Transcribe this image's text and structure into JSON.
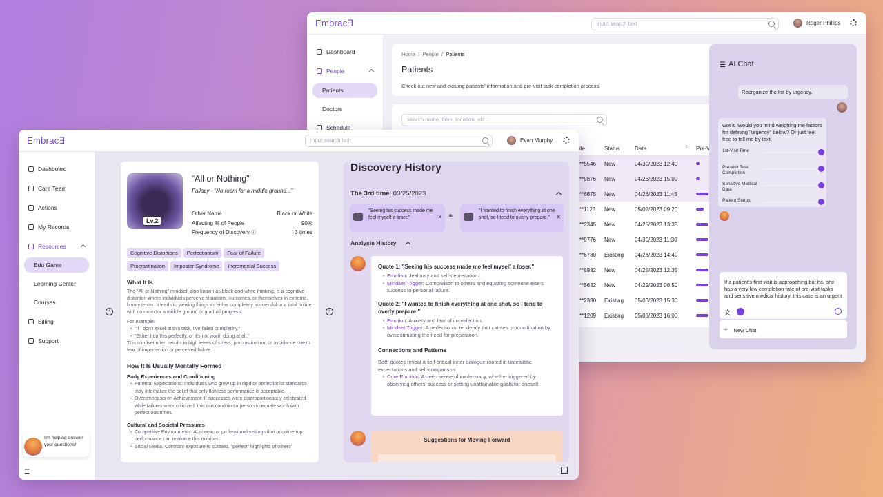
{
  "back_window": {
    "logo": "Embrac∃",
    "search_placeholder": "input search text",
    "user_name": "Roger Phillips",
    "nav": [
      {
        "label": "Dashboard"
      },
      {
        "label": "People"
      },
      {
        "label": "Patients"
      },
      {
        "label": "Doctors"
      },
      {
        "label": "Schedule"
      }
    ],
    "breadcrumb": {
      "home": "Home",
      "sep1": "/",
      "people": "People",
      "sep2": "/",
      "current": "Patients"
    },
    "page_title": "Patients",
    "page_subtitle": "Check out new and existing patients' information and pre-visit task completion process.",
    "filter_placeholder": "search name, time, location, etc...",
    "table": {
      "headers": [
        "ile",
        "Status",
        "Date",
        "Pre-V"
      ],
      "rows": [
        {
          "id": "**5546",
          "status": "New",
          "date": "04/30/2023 12:40",
          "progress": 0.05
        },
        {
          "id": "**9876",
          "status": "New",
          "date": "04/26/2023 15:00",
          "progress": 0.05
        },
        {
          "id": "**6675",
          "status": "New",
          "date": "04/26/2023 11:45",
          "progress": 0.6
        },
        {
          "id": "**1123",
          "status": "New",
          "date": "05/02/2023 09:20",
          "progress": 0.35
        },
        {
          "id": "**2345",
          "status": "New",
          "date": "04/25/2023 13:35",
          "progress": 0.6
        },
        {
          "id": "**9776",
          "status": "New",
          "date": "04/30/2023 11:30",
          "progress": 0.6
        },
        {
          "id": "**6780",
          "status": "Existing",
          "date": "04/28/2023 14:40",
          "progress": 0.6
        },
        {
          "id": "**8932",
          "status": "New",
          "date": "04/25/2023 12:35",
          "progress": 0.6
        },
        {
          "id": "**5632",
          "status": "New",
          "date": "04/29/2023 08:50",
          "progress": 0.6
        },
        {
          "id": "**2330",
          "status": "Existing",
          "date": "05/03/2023 15:30",
          "progress": 0.6
        },
        {
          "id": "**1209",
          "status": "Existing",
          "date": "05/03/2023 16:00",
          "progress": 0.6
        }
      ]
    },
    "ai_chat": {
      "title": "AI Chat",
      "user_msg": "Reorganize the list by urgency.",
      "bot_msg": "Got it. Would you mind weighing the factors for defining \"urgency\" below? Or just feel free to tell me by text.",
      "factors": [
        {
          "label": "1st-Visit Time",
          "value": 1.0
        },
        {
          "label": "Pre-visit Task Completion",
          "value": 1.0
        },
        {
          "label": "Sensitive Medical Data",
          "value": 1.0
        },
        {
          "label": "Patient Status",
          "value": 1.0
        }
      ],
      "input_text": "If a patient's first visit is approaching but he/ she has a very low completion rate of pre-visit tasks and sensitive medical history, this case is an urgent one for me.",
      "new_chat": "New Chat"
    }
  },
  "front_window": {
    "logo": "Embrac∃",
    "search_placeholder": "input search text",
    "user_name": "Evan Murphy",
    "nav": [
      {
        "label": "Dashboard"
      },
      {
        "label": "Care Team"
      },
      {
        "label": "Actions"
      },
      {
        "label": "My Records"
      },
      {
        "label": "Resources"
      },
      {
        "label": "Edu Game"
      },
      {
        "label": "Learning Center"
      },
      {
        "label": "Courses"
      },
      {
        "label": "Billing"
      },
      {
        "label": "Support"
      }
    ],
    "helper_bubble": "I'm helping answer your questions!",
    "fallacy": {
      "title": "“All or Nothing”",
      "subtitle": "Fallacy - “No room for a middle ground...”",
      "level": "Lv.2",
      "other_name_label": "Other Name",
      "other_name": "Black or White",
      "affecting_label": "Affecting % of People",
      "affecting": "90%",
      "frequency_label": "Frequency of Discovery",
      "frequency": "3 times",
      "tags": [
        "Cognitive Distortions",
        "Perfectionism",
        "Fear of Failure",
        "Procrastination",
        "Imposter Syndrome",
        "Incremental Success"
      ],
      "what_title": "What It Is",
      "what_text": "The \"All or Nothing\" mindset, also known as black-and-white thinking, is a cognitive distortion where individuals perceive situations, outcomes, or themselves in extreme, binary terms. It leads to viewing things as either completely successful or a total failure, with no room for a middle ground or gradual progress.",
      "example_label": "For example:",
      "example1": "\"If I don't excel at this task, I've failed completely.\"",
      "example2": "\"Either I do this perfectly, or it's not worth doing at all.\"",
      "example_after": "This mindset often results in high levels of stress, procrastination, or avoidance due to fear of imperfection or perceived failure.",
      "how_title": "How It Is Usually Mentally Formed",
      "early_title": "Early Experiences and Conditioning",
      "early1": "Parental Expectations: Individuals who grew up in rigid or perfectionist standards may internalize the belief that only flawless performance is acceptable.",
      "early2": "Overemphasis on Achievement: If successes were disproportionately celebrated while failures were criticized, this can condition a person to equate worth with perfect outcomes.",
      "cultural_title": "Cultural and Societal Pressures",
      "cultural1": "Competitive Environments: Academic or professional settings that prioritize top performance can reinforce this mindset.",
      "cultural2": "Social Media: Constant exposure to curated, \"perfect\" highlights of others'"
    },
    "discovery": {
      "title": "Discovery History",
      "time_label": "The 3rd time",
      "time_date": "03/25/2023",
      "quote_chip1": "\"Seeing his success made me feel myself a loser.\"",
      "quote_chip2": "\"I wanted to finish everything at one shot, so I tend to overly prepare.\"",
      "analysis_title": "Analysis History",
      "q1_title": "Quote 1: \"Seeing his success made me feel myself a loser.\"",
      "q1_emotion_label": "Emotion:",
      "q1_emotion": " Jealousy and self-deprecation.",
      "q1_trigger_label": "Mindset Trigger:",
      "q1_trigger": " Comparison to others and equating someone else's success to personal failure.",
      "q2_title": "Quote 2: \"I wanted to finish everything at one shot, so I tend to overly prepare.\"",
      "q2_emotion_label": "Emotion:",
      "q2_emotion": " Anxiety and fear of imperfection.",
      "q2_trigger_label": "Mindset Trigger:",
      "q2_trigger": " A perfectionist tendency that causes procrastination by overestimating the need for preparation.",
      "conn_title": "Connections and Patterns",
      "conn_text": "Both quotes reveal a self-critical inner dialogue rooted in unrealistic expectations and self-comparison:",
      "core_label": "Core Emotion:",
      "core_text": " A deep sense of inadequacy, whether triggered by observing others' success or setting unattainable goals for oneself.",
      "suggest_title": "Suggestions for Moving Forward"
    }
  }
}
